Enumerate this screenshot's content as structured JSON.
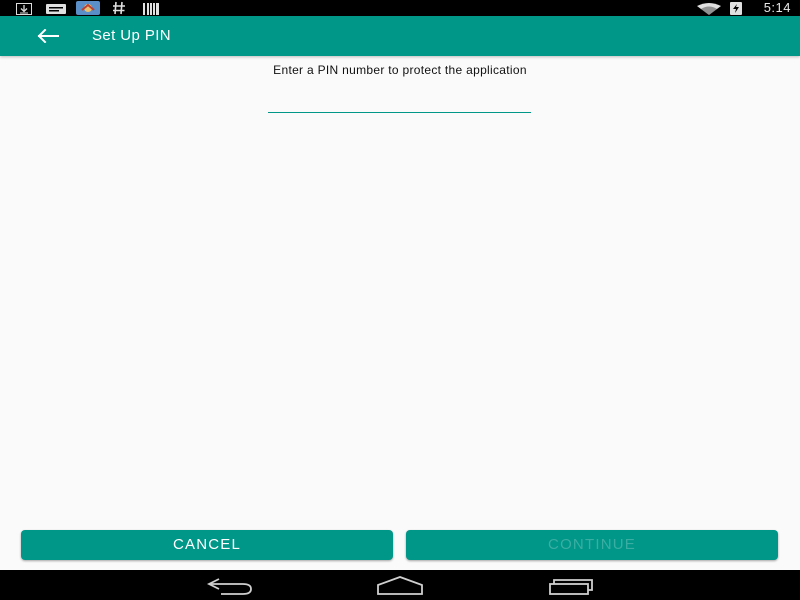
{
  "status_bar": {
    "time": "5:14",
    "left_icons": [
      "download-icon",
      "message-icon",
      "photo-notification-icon",
      "hash-icon",
      "barcode-icon"
    ],
    "right_icons": [
      "wifi-icon",
      "battery-charging-icon"
    ]
  },
  "app_bar": {
    "title": "Set Up PIN",
    "back_icon": "arrow-back-icon"
  },
  "main": {
    "prompt": "Enter a PIN number to protect the application",
    "pin_value": "",
    "pin_placeholder": ""
  },
  "buttons": {
    "cancel_label": "CANCEL",
    "continue_label": "CONTINUE",
    "continue_enabled": false
  },
  "nav_bar": {
    "icons": [
      "back-nav-icon",
      "home-nav-icon",
      "recents-nav-icon"
    ]
  },
  "colors": {
    "primary": "#009688",
    "background": "#fafafa",
    "disabled_text": "#3aaea2"
  }
}
